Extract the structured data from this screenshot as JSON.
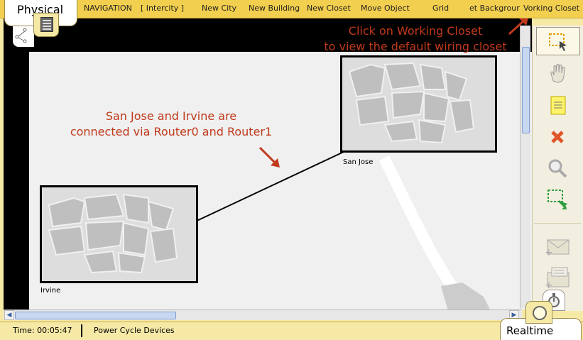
{
  "mode_tab": {
    "label": "Physical"
  },
  "nav_items": [
    {
      "label": "NAVIGATION"
    },
    {
      "label": "[ Intercity ]"
    },
    {
      "label": "New City"
    },
    {
      "label": "New Building"
    },
    {
      "label": "New Closet"
    },
    {
      "label": "Move Object"
    },
    {
      "label": "Grid"
    },
    {
      "label": "et Backgrour"
    },
    {
      "label": "Vorking Closet"
    }
  ],
  "annotations": {
    "closet_hint_line1": "Click on Working Closet",
    "closet_hint_line2": "to view the default wiring closet",
    "connect_line1": "San Jose and Irvine are",
    "connect_line2": "connected via Router0 and Router1"
  },
  "cities": {
    "san_jose": "San Jose",
    "irvine": "Irvine"
  },
  "tools": [
    {
      "icon": "select-icon",
      "active": true
    },
    {
      "icon": "hand-move-icon"
    },
    {
      "icon": "note-icon"
    },
    {
      "icon": "delete-icon"
    },
    {
      "icon": "zoom-icon"
    },
    {
      "icon": "resize-icon"
    },
    {
      "icon": "add-simple-pdu-icon"
    },
    {
      "icon": "add-complex-pdu-icon"
    }
  ],
  "status": {
    "time": "Time: 00:05:47",
    "power_cycle": "Power Cycle Devices"
  },
  "mode_bottom": {
    "label": "Realtime"
  },
  "colors": {
    "toolbar": "#f2cf4e",
    "annotation": "#c0391b",
    "canvas": "#f0f0f0"
  }
}
